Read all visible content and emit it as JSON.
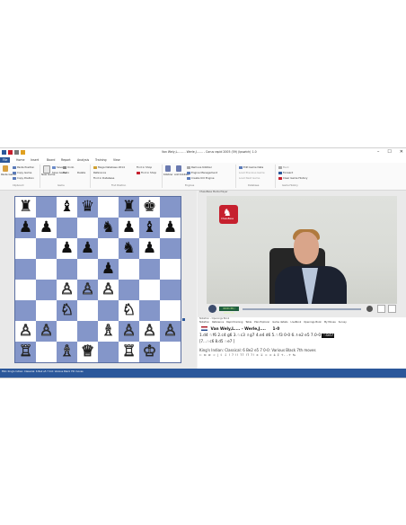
{
  "window": {
    "title": "Van Wely,L....... - Werle,J....... - Corus rapid 2005 (59) (Ipswich) 1-0",
    "controls": [
      "–",
      "☐",
      "✕"
    ]
  },
  "menu": {
    "items": [
      "File",
      "Home",
      "Insert",
      "Board",
      "Report",
      "Analysis",
      "Training",
      "View"
    ]
  },
  "ribbon": {
    "clipboard": {
      "items": [
        "Paste Game",
        "Paste Position",
        "Copy Game",
        "Copy Position"
      ],
      "group": "Clipboard"
    },
    "game": {
      "items": [
        "New Game",
        "Save",
        "Save Game",
        "Undo",
        "Redo",
        "Delete"
      ],
      "group": "Game"
    },
    "find_position": {
      "items": [
        "Mega Database 2014",
        "Find in Shop",
        "Reference",
        "Find in Database",
        "Find in Shop"
      ],
      "group": "Find Position"
    },
    "engines": {
      "items": [
        "Kibitzer",
        "Add Kibitzer",
        "Remove Kibitzer",
        "Engine Management",
        "Create UCI Engine"
      ],
      "group": "Engines"
    },
    "database": {
      "items": [
        "Edit Game Data",
        "Load Previous Game",
        "Load Next Game"
      ],
      "group": "Database"
    },
    "game_history": {
      "items": [
        "Back",
        "Forward",
        "Clear Game History"
      ],
      "group": "Game History"
    }
  },
  "board": {
    "rows": [
      [
        "♜",
        "",
        "♝",
        "♛",
        "",
        "♜",
        "♚",
        ""
      ],
      [
        "♟",
        "♟",
        "",
        "",
        "♞",
        "♟",
        "♝",
        "♟"
      ],
      [
        "",
        "",
        "♟",
        "♟",
        "",
        "♞",
        "♟",
        ""
      ],
      [
        "",
        "",
        "",
        "",
        "♟",
        "",
        "",
        ""
      ],
      [
        "",
        "",
        "♙",
        "♙",
        "♙",
        "",
        "",
        ""
      ],
      [
        "",
        "",
        "♘",
        "",
        "",
        "♘",
        "",
        ""
      ],
      [
        "♙",
        "♙",
        "",
        "",
        "♗",
        "♙",
        "♙",
        "♙"
      ],
      [
        "♖",
        "",
        "♗",
        "♕",
        "",
        "♖",
        "♔",
        ""
      ]
    ],
    "white_pieces": [
      "♔",
      "♕",
      "♖",
      "♗",
      "♘",
      "♙"
    ]
  },
  "video": {
    "panel_title": "ChessBase Media Player",
    "logo_text": "ChessBase",
    "timecode": "00:01:58 / 00:07:52"
  },
  "notation": {
    "panel_title": "Notation - Openings Book",
    "tabs": [
      "Notation",
      "Reference",
      "Rapid training",
      "Table",
      "Plan Explorer",
      "Game details",
      "LiveBook",
      "Openings Book",
      "My Moves",
      "Survey"
    ],
    "white_player": "Van Wely,L....",
    "black_player": "Werle,J....",
    "result": "1-0",
    "moves_main": "1.d4 ♘f6 2.c4 g6 3.♘c3 ♗g7 4.e4 d6 5.♘f3 0-0 6.♗e2 e5 7.0-0",
    "highlighted_move": "♘bd7",
    "moves_variation": "[7...♘c6 8.d5 ♘e7 ]",
    "opening": "King's Indian: Classical: 6 Be2 e5 7 0-0: Various Black 7th moves",
    "toolbar": "⇐ ⇚ ⇛ ⇒ | ⇧ ⇩ ! ? !! ?? !? ?! ± ∓ = ∞ ⩲ ⩱ +- -+ ⇆"
  },
  "status": {
    "text": "E94: King's Indian: Classical: 6 Be2 e5 7 0-0: Various Black 7th moves"
  },
  "colors": {
    "accent": "#2b579a",
    "board_dark": "#8496c9",
    "board_light": "#ffffff",
    "logo": "#c6202e"
  }
}
